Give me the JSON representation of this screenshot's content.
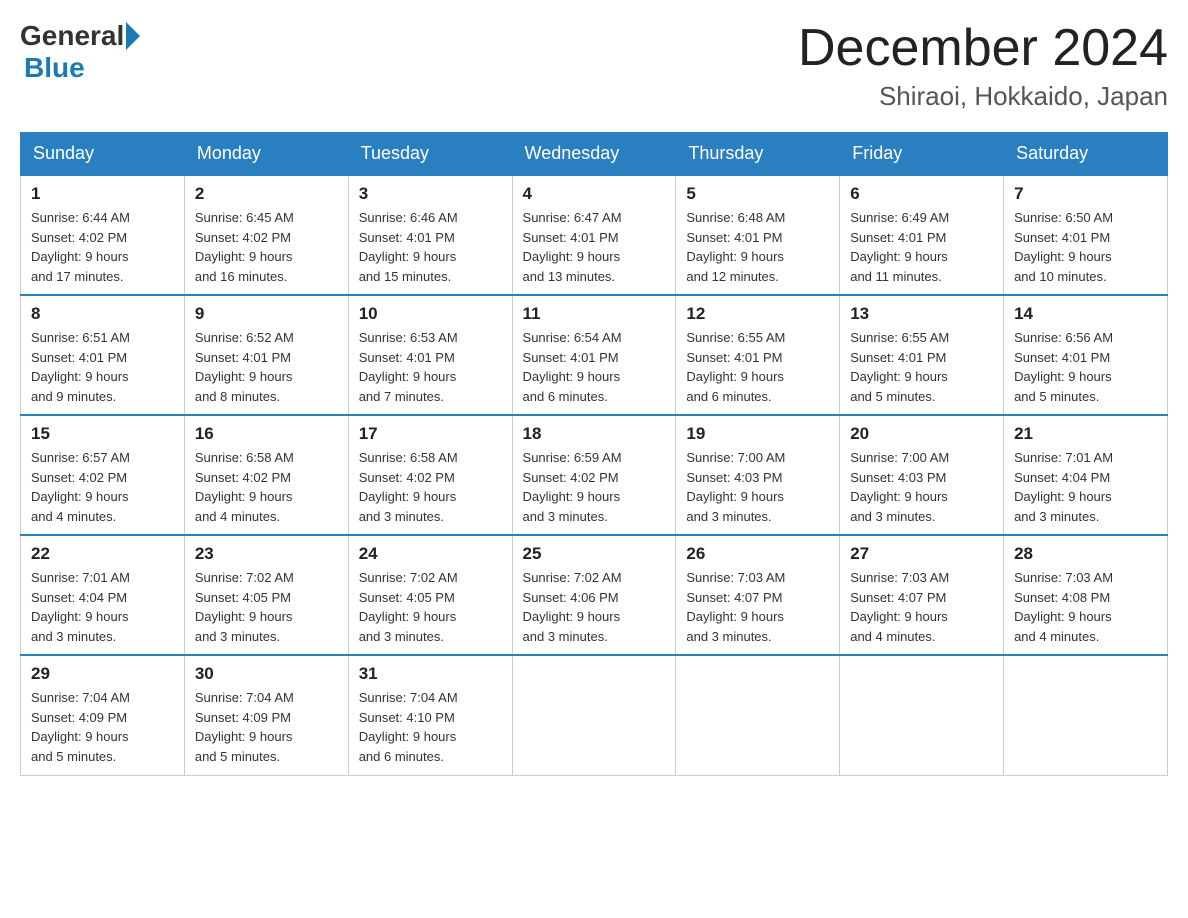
{
  "logo": {
    "general": "General",
    "blue": "Blue"
  },
  "title": "December 2024",
  "location": "Shiraoi, Hokkaido, Japan",
  "days_of_week": [
    "Sunday",
    "Monday",
    "Tuesday",
    "Wednesday",
    "Thursday",
    "Friday",
    "Saturday"
  ],
  "weeks": [
    [
      {
        "day": "1",
        "sunrise": "6:44 AM",
        "sunset": "4:02 PM",
        "daylight": "9 hours and 17 minutes."
      },
      {
        "day": "2",
        "sunrise": "6:45 AM",
        "sunset": "4:02 PM",
        "daylight": "9 hours and 16 minutes."
      },
      {
        "day": "3",
        "sunrise": "6:46 AM",
        "sunset": "4:01 PM",
        "daylight": "9 hours and 15 minutes."
      },
      {
        "day": "4",
        "sunrise": "6:47 AM",
        "sunset": "4:01 PM",
        "daylight": "9 hours and 13 minutes."
      },
      {
        "day": "5",
        "sunrise": "6:48 AM",
        "sunset": "4:01 PM",
        "daylight": "9 hours and 12 minutes."
      },
      {
        "day": "6",
        "sunrise": "6:49 AM",
        "sunset": "4:01 PM",
        "daylight": "9 hours and 11 minutes."
      },
      {
        "day": "7",
        "sunrise": "6:50 AM",
        "sunset": "4:01 PM",
        "daylight": "9 hours and 10 minutes."
      }
    ],
    [
      {
        "day": "8",
        "sunrise": "6:51 AM",
        "sunset": "4:01 PM",
        "daylight": "9 hours and 9 minutes."
      },
      {
        "day": "9",
        "sunrise": "6:52 AM",
        "sunset": "4:01 PM",
        "daylight": "9 hours and 8 minutes."
      },
      {
        "day": "10",
        "sunrise": "6:53 AM",
        "sunset": "4:01 PM",
        "daylight": "9 hours and 7 minutes."
      },
      {
        "day": "11",
        "sunrise": "6:54 AM",
        "sunset": "4:01 PM",
        "daylight": "9 hours and 6 minutes."
      },
      {
        "day": "12",
        "sunrise": "6:55 AM",
        "sunset": "4:01 PM",
        "daylight": "9 hours and 6 minutes."
      },
      {
        "day": "13",
        "sunrise": "6:55 AM",
        "sunset": "4:01 PM",
        "daylight": "9 hours and 5 minutes."
      },
      {
        "day": "14",
        "sunrise": "6:56 AM",
        "sunset": "4:01 PM",
        "daylight": "9 hours and 5 minutes."
      }
    ],
    [
      {
        "day": "15",
        "sunrise": "6:57 AM",
        "sunset": "4:02 PM",
        "daylight": "9 hours and 4 minutes."
      },
      {
        "day": "16",
        "sunrise": "6:58 AM",
        "sunset": "4:02 PM",
        "daylight": "9 hours and 4 minutes."
      },
      {
        "day": "17",
        "sunrise": "6:58 AM",
        "sunset": "4:02 PM",
        "daylight": "9 hours and 3 minutes."
      },
      {
        "day": "18",
        "sunrise": "6:59 AM",
        "sunset": "4:02 PM",
        "daylight": "9 hours and 3 minutes."
      },
      {
        "day": "19",
        "sunrise": "7:00 AM",
        "sunset": "4:03 PM",
        "daylight": "9 hours and 3 minutes."
      },
      {
        "day": "20",
        "sunrise": "7:00 AM",
        "sunset": "4:03 PM",
        "daylight": "9 hours and 3 minutes."
      },
      {
        "day": "21",
        "sunrise": "7:01 AM",
        "sunset": "4:04 PM",
        "daylight": "9 hours and 3 minutes."
      }
    ],
    [
      {
        "day": "22",
        "sunrise": "7:01 AM",
        "sunset": "4:04 PM",
        "daylight": "9 hours and 3 minutes."
      },
      {
        "day": "23",
        "sunrise": "7:02 AM",
        "sunset": "4:05 PM",
        "daylight": "9 hours and 3 minutes."
      },
      {
        "day": "24",
        "sunrise": "7:02 AM",
        "sunset": "4:05 PM",
        "daylight": "9 hours and 3 minutes."
      },
      {
        "day": "25",
        "sunrise": "7:02 AM",
        "sunset": "4:06 PM",
        "daylight": "9 hours and 3 minutes."
      },
      {
        "day": "26",
        "sunrise": "7:03 AM",
        "sunset": "4:07 PM",
        "daylight": "9 hours and 3 minutes."
      },
      {
        "day": "27",
        "sunrise": "7:03 AM",
        "sunset": "4:07 PM",
        "daylight": "9 hours and 4 minutes."
      },
      {
        "day": "28",
        "sunrise": "7:03 AM",
        "sunset": "4:08 PM",
        "daylight": "9 hours and 4 minutes."
      }
    ],
    [
      {
        "day": "29",
        "sunrise": "7:04 AM",
        "sunset": "4:09 PM",
        "daylight": "9 hours and 5 minutes."
      },
      {
        "day": "30",
        "sunrise": "7:04 AM",
        "sunset": "4:09 PM",
        "daylight": "9 hours and 5 minutes."
      },
      {
        "day": "31",
        "sunrise": "7:04 AM",
        "sunset": "4:10 PM",
        "daylight": "9 hours and 6 minutes."
      },
      null,
      null,
      null,
      null
    ]
  ],
  "labels": {
    "sunrise": "Sunrise:",
    "sunset": "Sunset:",
    "daylight": "Daylight:"
  }
}
